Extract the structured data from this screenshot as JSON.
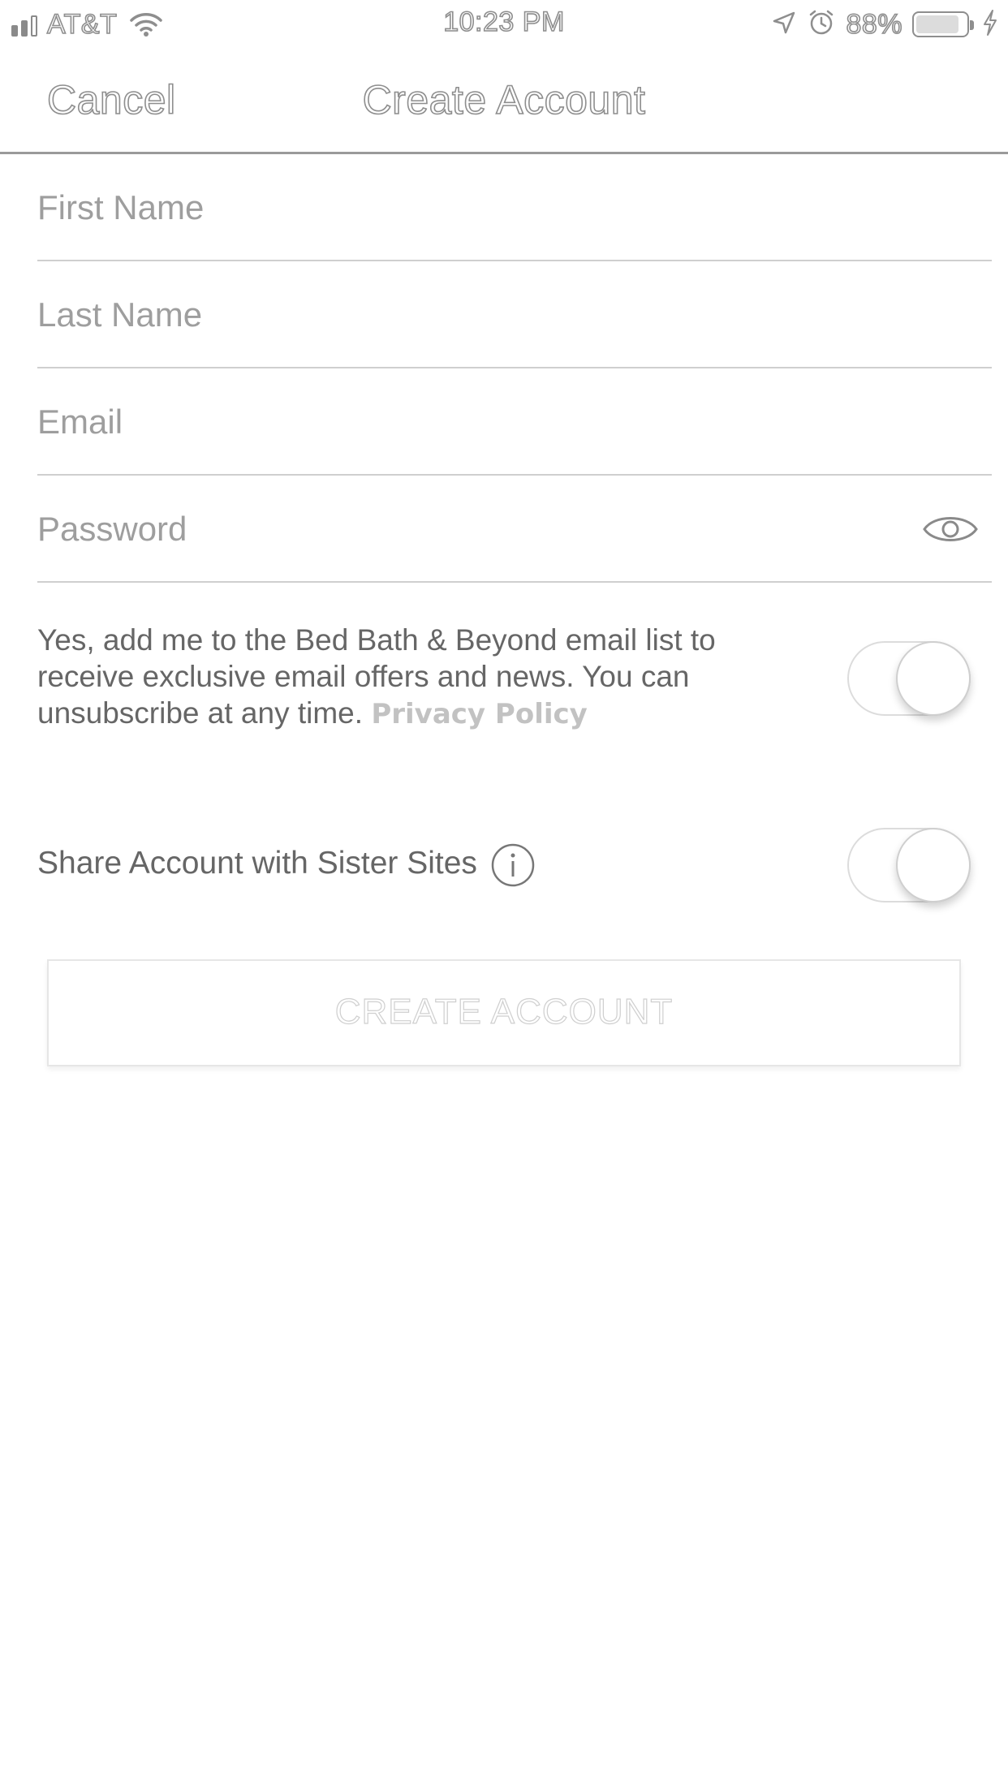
{
  "status_bar": {
    "carrier": "AT&T",
    "time": "10:23 PM",
    "battery_percent": "88%",
    "battery_level": 0.88,
    "icons": [
      "signal-icon",
      "wifi-icon",
      "location-icon",
      "alarm-icon",
      "battery-icon",
      "charging-icon"
    ]
  },
  "nav": {
    "cancel_label": "Cancel",
    "title": "Create Account"
  },
  "form": {
    "first_name": {
      "placeholder": "First Name",
      "value": ""
    },
    "last_name": {
      "placeholder": "Last Name",
      "value": ""
    },
    "email": {
      "placeholder": "Email",
      "value": ""
    },
    "password": {
      "placeholder": "Password",
      "value": ""
    }
  },
  "optin": {
    "text": "Yes, add me to the Bed Bath & Beyond email list to receive exclusive email offers and news. You can unsubscribe at any time. ",
    "privacy_link": "Privacy Policy",
    "toggle_on": false
  },
  "share": {
    "label": "Share Account with Sister Sites",
    "toggle_on": false
  },
  "create_button": {
    "label": "CREATE ACCOUNT"
  },
  "colors": {
    "background": "#ffffff",
    "text": "#666666",
    "placeholder": "#9e9e9e",
    "divider": "#cfcfcf"
  }
}
